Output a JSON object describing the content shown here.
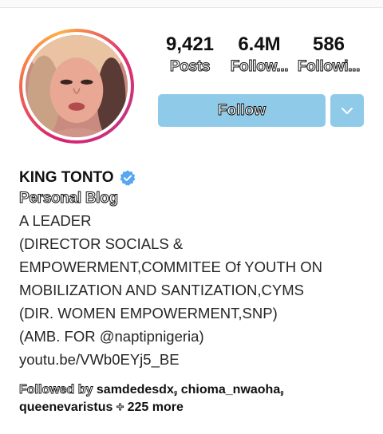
{
  "profile": {
    "name": "KING TONTO",
    "category": "Personal Blog",
    "verified": true
  },
  "stats": {
    "posts": {
      "value": "9,421",
      "label": "Posts"
    },
    "followers": {
      "value": "6.4M",
      "label": "Follow..."
    },
    "following": {
      "value": "586",
      "label": "Followi..."
    }
  },
  "actions": {
    "follow_label": "Follow",
    "dropdown_icon": "chevron-down-icon"
  },
  "bio": {
    "lines": [
      "A LEADER",
      "(DIRECTOR SOCIALS &",
      "EMPOWERMENT,COMMITEE Of YOUTH ON",
      "MOBILIZATION AND SANTIZATION,CYMS",
      "(DIR. WOMEN EMPOWERMENT,SNP)",
      "(AMB. FOR @naptipnigeria)"
    ],
    "link": "youtu.be/VWb0EYj5_BE"
  },
  "followed_by": {
    "label": "Followed by",
    "users": [
      "samdedesdx",
      "chioma_nwaoha",
      "queenevaristus"
    ],
    "more": "225 more"
  },
  "colors": {
    "button": "#8fcbe8",
    "verified": "#3897f0",
    "text": "#262626"
  }
}
